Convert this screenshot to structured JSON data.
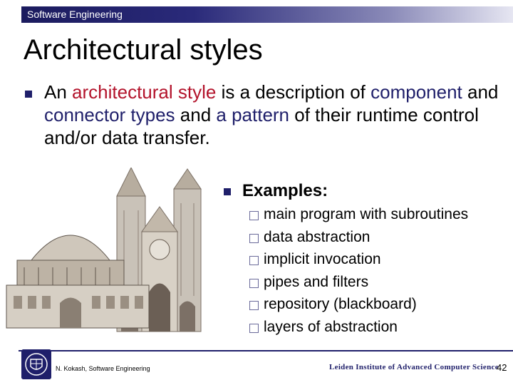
{
  "header": {
    "course": "Software Engineering"
  },
  "slide": {
    "title": "Architectural styles",
    "intro": {
      "part1": "An ",
      "part2": "architectural style",
      "part3": " is a description of ",
      "part4": "component",
      "part5": " and ",
      "part6": "connector types",
      "part7": " and ",
      "part8": "a pattern",
      "part9": " of their runtime control and/or data transfer."
    },
    "examples_label": "Examples:",
    "examples": [
      "main program with subroutines",
      "data abstraction",
      "implicit invocation",
      "pipes and filters",
      "repository (blackboard)",
      "layers of abstraction"
    ]
  },
  "footer": {
    "author": "N. Kokash, Software Engineering",
    "institute": "Leiden Institute of Advanced Computer Science",
    "page": "42"
  },
  "colors": {
    "accent": "#1f1f6a",
    "highlight": "#b3132b"
  },
  "icons": {
    "bullet": "square-bullet-icon",
    "sub_bullet": "checkbox-bullet-icon",
    "logo": "university-seal-logo"
  }
}
